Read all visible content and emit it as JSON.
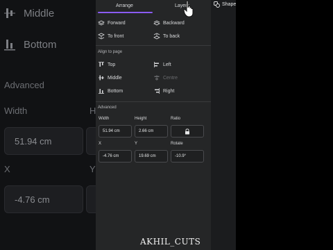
{
  "background": {
    "rows": [
      {
        "label": "Middle"
      },
      {
        "label": "Bottom"
      }
    ],
    "advanced_label": "Advanced",
    "width_label": "Width",
    "height_partial": "H",
    "width_value": "51.94 cm",
    "x_label": "X",
    "y_partial": "Y",
    "x_value": "-4.76 cm"
  },
  "tabs": [
    {
      "label": "Arrange",
      "active": true
    },
    {
      "label": "Layers",
      "active": false
    }
  ],
  "shapes_label": "Shape",
  "order": [
    {
      "label": "Forward",
      "icon": "forward-icon"
    },
    {
      "label": "Backward",
      "icon": "backward-icon"
    },
    {
      "label": "To front",
      "icon": "to-front-icon"
    },
    {
      "label": "To back",
      "icon": "to-back-icon"
    }
  ],
  "align_section": "Align to page",
  "align": [
    {
      "label": "Top",
      "icon": "align-top-icon",
      "enabled": true
    },
    {
      "label": "Left",
      "icon": "align-left-icon",
      "enabled": true
    },
    {
      "label": "Middle",
      "icon": "align-middle-icon",
      "enabled": true
    },
    {
      "label": "Centre",
      "icon": "align-centre-icon",
      "enabled": false
    },
    {
      "label": "Bottom",
      "icon": "align-bottom-icon",
      "enabled": true
    },
    {
      "label": "Right",
      "icon": "align-right-icon",
      "enabled": true
    }
  ],
  "advanced_section": "Advanced",
  "fields": {
    "width": {
      "label": "Width",
      "value": "51.94 cm"
    },
    "height": {
      "label": "Height",
      "value": "2.66 cm"
    },
    "ratio": {
      "label": "Ratio"
    },
    "x": {
      "label": "X",
      "value": "-4.76 cm"
    },
    "y": {
      "label": "Y",
      "value": "19.69 cm"
    },
    "rotate": {
      "label": "Rotate",
      "value": "-10.9°"
    }
  },
  "watermark": "AKHIL_CUTS"
}
